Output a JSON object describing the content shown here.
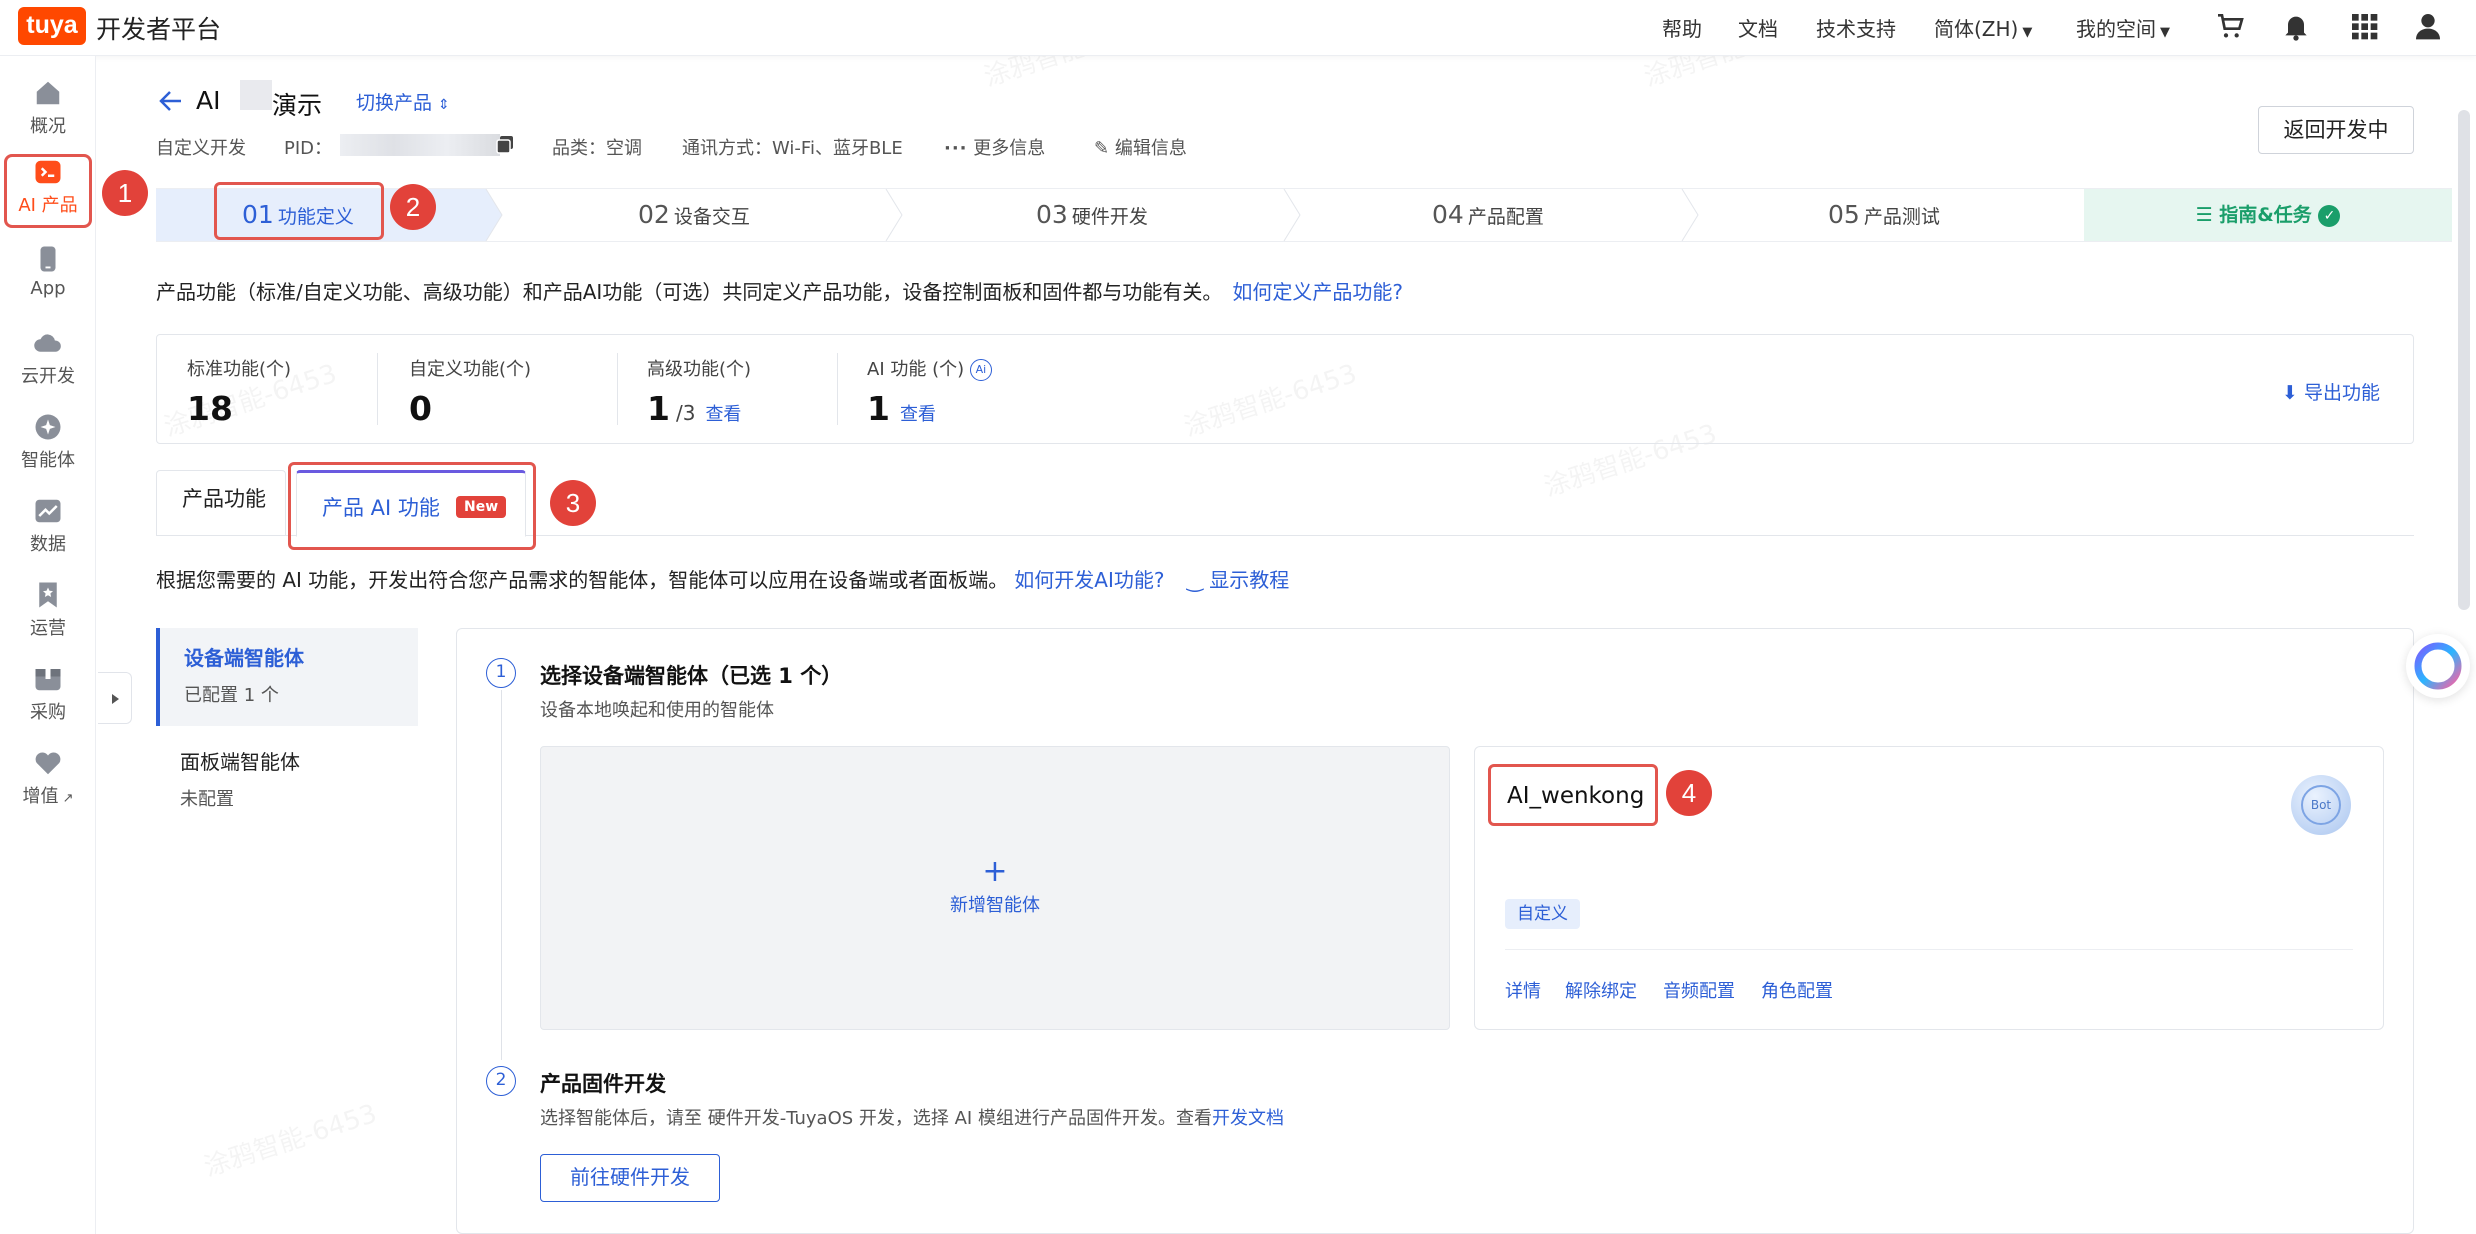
{
  "topbar": {
    "logo_text": "tuya",
    "platform_name": "开发者平台",
    "nav": [
      "帮助",
      "文档",
      "技术支持",
      "简体(ZH)",
      "我的空间"
    ],
    "icons": [
      "cart-icon",
      "bell-icon",
      "apps-grid-icon",
      "user-icon"
    ]
  },
  "sidebar": {
    "items": [
      {
        "label": "概况",
        "icon": "home-icon"
      },
      {
        "label": "AI 产品",
        "icon": "ai-product-icon",
        "active": true
      },
      {
        "label": "App",
        "icon": "app-phone-icon"
      },
      {
        "label": "云开发",
        "icon": "cloud-icon"
      },
      {
        "label": "智能体",
        "icon": "agent-icon"
      },
      {
        "label": "数据",
        "icon": "chart-icon"
      },
      {
        "label": "运营",
        "icon": "bookmark-icon"
      },
      {
        "label": "采购",
        "icon": "box-icon"
      },
      {
        "label": "增值",
        "icon": "heart-icon"
      }
    ]
  },
  "annotations": [
    "1",
    "2",
    "3",
    "4"
  ],
  "header": {
    "title_prefix": "AI",
    "title_suffix": "演示",
    "switch_product": "切换产品",
    "dev_type": "自定义开发",
    "pid_label": "PID：",
    "category": "品类：空调",
    "comm": "通讯方式：Wi-Fi、蓝牙BLE",
    "more_info": "更多信息",
    "edit_info": "编辑信息",
    "return_btn": "返回开发中"
  },
  "steps": {
    "items": [
      {
        "num": "01",
        "label": "功能定义"
      },
      {
        "num": "02",
        "label": "设备交互"
      },
      {
        "num": "03",
        "label": "硬件开发"
      },
      {
        "num": "04",
        "label": "产品配置"
      },
      {
        "num": "05",
        "label": "产品测试"
      }
    ],
    "guide": "指南&任务"
  },
  "description": {
    "text": "产品功能（标准/自定义功能、高级功能）和产品AI功能（可选）共同定义产品功能，设备控制面板和固件都与功能有关。",
    "link": "如何定义产品功能?"
  },
  "stats": {
    "standard": {
      "label": "标准功能(个)",
      "value": "18"
    },
    "custom": {
      "label": "自定义功能(个)",
      "value": "0"
    },
    "advanced": {
      "label": "高级功能(个)",
      "value": "1",
      "sub": "/3",
      "link": "查看"
    },
    "ai": {
      "label": "AI 功能 (个)",
      "value": "1",
      "link": "查看"
    },
    "export": "导出功能"
  },
  "tabs": {
    "product": "产品功能",
    "ai": "产品 AI 功能",
    "badge": "New"
  },
  "ai_desc": {
    "text": "根据您需要的 AI 功能，开发出符合您产品需求的智能体，智能体可以应用在设备端或者面板端。",
    "link": "如何开发AI功能?",
    "tutorial": "显示教程"
  },
  "agent_types": [
    {
      "title": "设备端智能体",
      "sub": "已配置 1 个"
    },
    {
      "title": "面板端智能体",
      "sub": "未配置"
    }
  ],
  "section1": {
    "num": "1",
    "title": "选择设备端智能体（已选 1 个）",
    "sub": "设备本地唤起和使用的智能体",
    "add_label": "新增智能体",
    "add_plus": "+"
  },
  "agent_card": {
    "name": "AI_wenkong",
    "bot_label": "Bot",
    "tag": "自定义",
    "actions": [
      "详情",
      "解除绑定",
      "音频配置",
      "角色配置"
    ]
  },
  "section2": {
    "num": "2",
    "title": "产品固件开发",
    "sub": "选择智能体后，请至 硬件开发-TuyaOS 开发，选择 AI 模组进行产品固件开发。查看",
    "sub_link": "开发文档",
    "button": "前往硬件开发"
  },
  "watermark": "涂鸦智能-6453",
  "colors": {
    "brand": "#ff4800",
    "link": "#2d5fd6",
    "annotation": "#e2423a",
    "guide": "#1a9e6a"
  }
}
